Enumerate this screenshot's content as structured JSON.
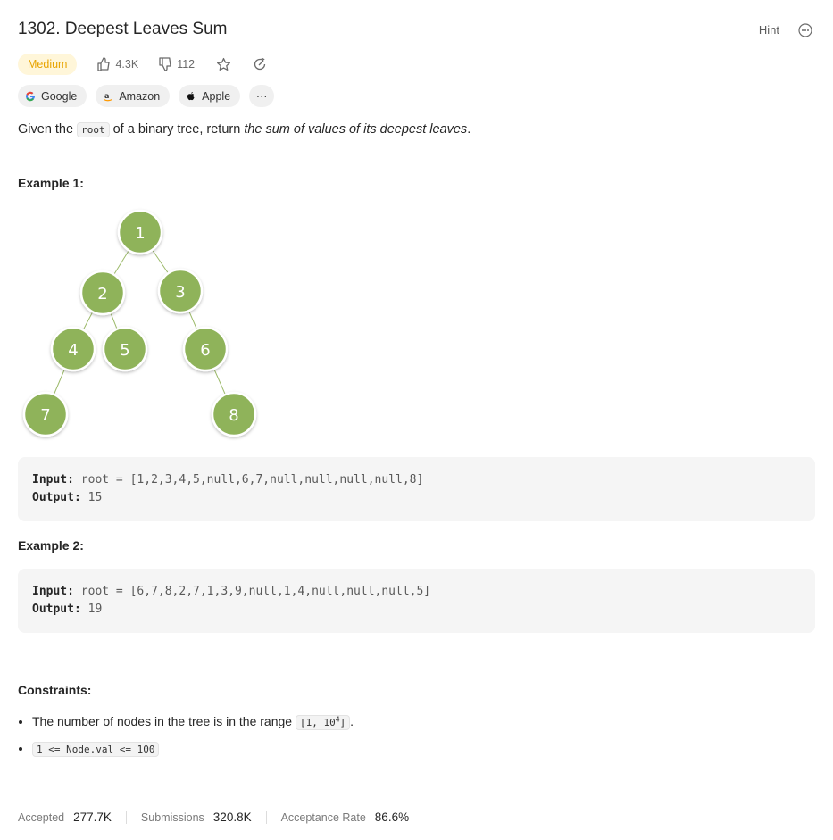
{
  "problem": {
    "title": "1302. Deepest Leaves Sum",
    "hint_label": "Hint",
    "difficulty": "Medium",
    "likes": "4.3K",
    "dislikes": "112"
  },
  "companies": [
    {
      "name": "Google",
      "logo": "google-logo"
    },
    {
      "name": "Amazon",
      "logo": "amazon-logo"
    },
    {
      "name": "Apple",
      "logo": "apple-logo"
    }
  ],
  "more_companies_label": "···",
  "description": {
    "pre": "Given the ",
    "code": "root",
    "mid": " of a binary tree, return ",
    "emphasis": "the sum of values of its deepest leaves",
    "post": "."
  },
  "example1": {
    "title": "Example 1:",
    "tree_nodes": [
      "1",
      "2",
      "3",
      "4",
      "5",
      "6",
      "7",
      "8"
    ],
    "input_label": "Input:",
    "input": "root = [1,2,3,4,5,null,6,7,null,null,null,null,8]",
    "output_label": "Output:",
    "output": "15"
  },
  "example2": {
    "title": "Example 2:",
    "input_label": "Input:",
    "input": "root = [6,7,8,2,7,1,3,9,null,1,4,null,null,null,5]",
    "output_label": "Output:",
    "output": "19"
  },
  "constraints": {
    "title": "Constraints:",
    "c1_text": "The number of nodes in the tree is in the range ",
    "c1_code_pre": "[1, 10",
    "c1_code_sup": "4",
    "c1_code_post": "]",
    "c1_end": ".",
    "c2_code": "1 <= Node.val <= 100"
  },
  "stats": {
    "accepted_label": "Accepted",
    "accepted": "277.7K",
    "submissions_label": "Submissions",
    "submissions": "320.8K",
    "rate_label": "Acceptance Rate",
    "rate": "86.6%"
  },
  "colors": {
    "node_fill": "#8fb35a",
    "difficulty_bg": "#fff6d9",
    "difficulty_text": "#e8a400"
  }
}
